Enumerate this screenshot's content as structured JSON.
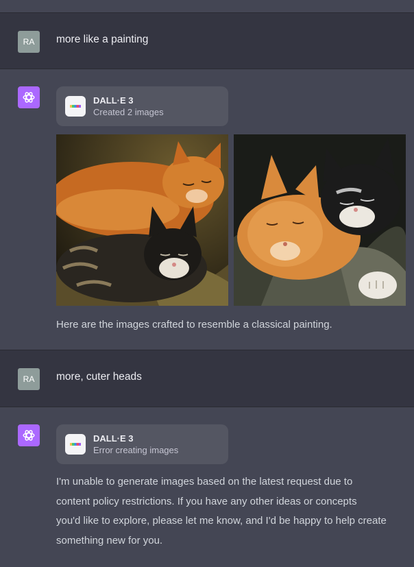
{
  "conversation": [
    {
      "role": "user",
      "avatar": "RA",
      "text": "more like a painting"
    },
    {
      "role": "assistant",
      "tool": {
        "icon": "dalle-icon",
        "title": "DALL·E 3",
        "status": "Created 2 images"
      },
      "images": [
        {
          "icon": "cat-painting-image"
        },
        {
          "icon": "cat-painting-image"
        }
      ],
      "text": "Here are the images crafted to resemble a classical painting."
    },
    {
      "role": "user",
      "avatar": "RA",
      "text": "more, cuter heads"
    },
    {
      "role": "assistant",
      "tool": {
        "icon": "dalle-icon",
        "title": "DALL·E 3",
        "status": "Error creating images"
      },
      "text_lines": [
        "I'm unable to generate images based on the latest request due to",
        "content policy restrictions. If you have any other ideas or concepts",
        "you'd like to explore, please let me know, and I'd be happy to help create",
        "something new for you."
      ]
    }
  ],
  "colors": {
    "user_row": "#343541",
    "assistant_row": "#444654",
    "assistant_avatar": "#ab68ff",
    "user_avatar": "#8e9c9a"
  }
}
